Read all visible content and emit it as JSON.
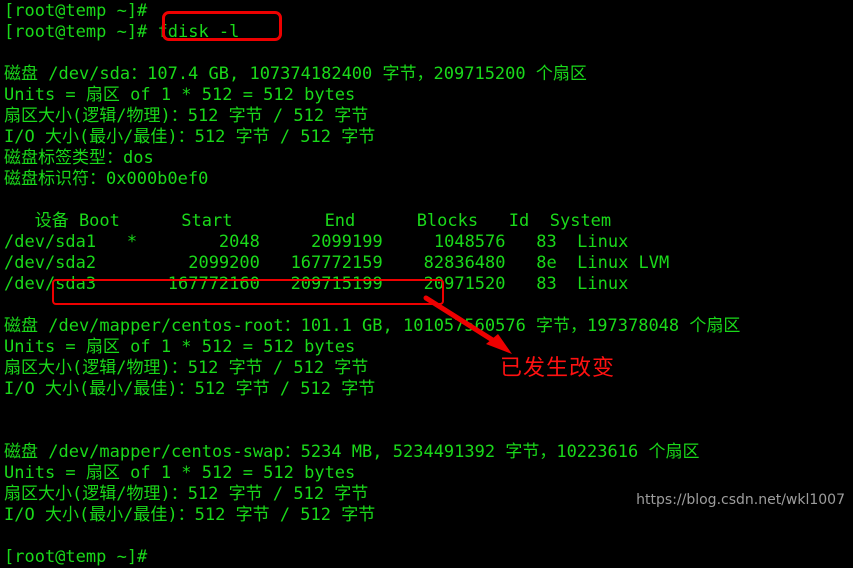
{
  "terminal": {
    "background_color": "#000000",
    "text_color": "#1ad91a",
    "annotation_color": "#ee0000",
    "watermark_color": "#b9b9b9",
    "lines": [
      "[root@temp ~]#",
      "[root@temp ~]# fdisk -l",
      "",
      "磁盘 /dev/sda：107.4 GB, 107374182400 字节，209715200 个扇区",
      "Units = 扇区 of 1 * 512 = 512 bytes",
      "扇区大小(逻辑/物理)：512 字节 / 512 字节",
      "I/O 大小(最小/最佳)：512 字节 / 512 字节",
      "磁盘标签类型：dos",
      "磁盘标识符：0x000b0ef0",
      "",
      "   设备 Boot      Start         End      Blocks   Id  System",
      "/dev/sda1   *        2048     2099199     1048576   83  Linux",
      "/dev/sda2         2099200   167772159    82836480   8e  Linux LVM",
      "/dev/sda3       167772160   209715199    20971520   83  Linux",
      "",
      "磁盘 /dev/mapper/centos-root：101.1 GB, 101057560576 字节，197378048 个扇区",
      "Units = 扇区 of 1 * 512 = 512 bytes",
      "扇区大小(逻辑/物理)：512 字节 / 512 字节",
      "I/O 大小(最小/最佳)：512 字节 / 512 字节",
      "",
      "",
      "磁盘 /dev/mapper/centos-swap：5234 MB, 5234491392 字节，10223616 个扇区",
      "Units = 扇区 of 1 * 512 = 512 bytes",
      "扇区大小(逻辑/物理)：512 字节 / 512 字节",
      "I/O 大小(最小/最佳)：512 字节 / 512 字节",
      "",
      "[root@temp ~]#"
    ],
    "command": "fdisk -l",
    "prompt": "[root@temp ~]#",
    "disks": [
      {
        "device": "/dev/sda",
        "size_human": "107.4 GB",
        "size_bytes": "107374182400",
        "sectors": "209715200",
        "units": "Units = 扇区 of 1 * 512 = 512 bytes",
        "sector_size": "扇区大小(逻辑/物理)：512 字节 / 512 字节",
        "io_size": "I/O 大小(最小/最佳)：512 字节 / 512 字节",
        "label_type": "磁盘标签类型：dos",
        "identifier": "磁盘标识符：0x000b0ef0"
      },
      {
        "device": "/dev/mapper/centos-root",
        "size_human": "101.1 GB",
        "size_bytes": "101057560576",
        "sectors": "197378048",
        "units": "Units = 扇区 of 1 * 512 = 512 bytes",
        "sector_size": "扇区大小(逻辑/物理)：512 字节 / 512 字节",
        "io_size": "I/O 大小(最小/最佳)：512 字节 / 512 字节"
      },
      {
        "device": "/dev/mapper/centos-swap",
        "size_human": "5234 MB",
        "size_bytes": "5234491392",
        "sectors": "10223616",
        "units": "Units = 扇区 of 1 * 512 = 512 bytes",
        "sector_size": "扇区大小(逻辑/物理)：512 字节 / 512 字节",
        "io_size": "I/O 大小(最小/最佳)：512 字节 / 512 字节"
      }
    ],
    "partition_table": {
      "headers": [
        "设备",
        "Boot",
        "Start",
        "End",
        "Blocks",
        "Id",
        "System"
      ],
      "rows": [
        {
          "device": "/dev/sda1",
          "boot": "*",
          "start": "2048",
          "end": "2099199",
          "blocks": "1048576",
          "id": "83",
          "system": "Linux"
        },
        {
          "device": "/dev/sda2",
          "boot": "",
          "start": "2099200",
          "end": "167772159",
          "blocks": "82836480",
          "id": "8e",
          "system": "Linux LVM"
        },
        {
          "device": "/dev/sda3",
          "boot": "",
          "start": "167772160",
          "end": "209715199",
          "blocks": "20971520",
          "id": "83",
          "system": "Linux"
        }
      ]
    }
  },
  "annotations": {
    "command_highlight": "fdisk -l",
    "disk_highlight": "/dev/mapper/centos-root：101.1 GB,",
    "changed_note": "已发生改变"
  },
  "watermark": {
    "text": "https://blog.csdn.net/wkl1007"
  }
}
